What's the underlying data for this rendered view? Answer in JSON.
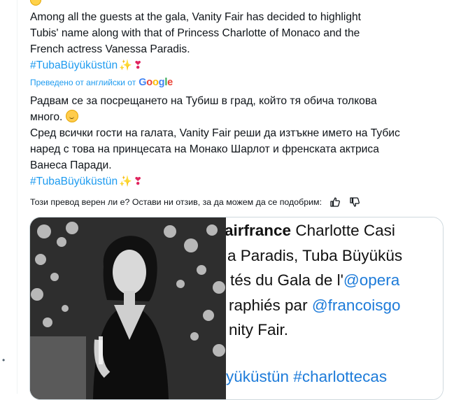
{
  "original": {
    "line1": "Among all the guests at the gala, Vanity Fair has decided to highlight",
    "line2": "Tubis' name along with that of Princess Charlotte of Monaco and the",
    "line3": "French actress Vanessa Paradis.",
    "hashtag": "#TubaBüyüküstün"
  },
  "translation": {
    "note": "Преведено от английски от",
    "provider": "Google",
    "line1": "Радвам се за посрещането на Тубиш в град, който тя обича толкова",
    "line2": "много.",
    "line3": "Сред всички гости на галата, Vanity Fair реши да изтъкне името на Тубис",
    "line4": "наред с това на принцесата на Монако Шарлот и френската актриса",
    "line5": "Ванеса Паради.",
    "hashtag": "#TubaBüyüküstün"
  },
  "feedback": {
    "question": "Този превод верен ли е? Остави ни отзив, за да можем да се подобрим:"
  },
  "icons": {
    "sparkles": "✨",
    "exclamation": "❣",
    "thumbs_up": "thumbs-up-icon",
    "thumbs_down": "thumbs-down-icon",
    "smiling_face": "smiling-face-with-tear-icon"
  },
  "media": {
    "screenshot_lines": [
      {
        "pre": "",
        "bold": "airfrance",
        "post": " Charlotte Casi"
      },
      {
        "pre": "a Paradis, Tuba Büyüküs",
        "bold": "",
        "post": ""
      },
      {
        "pre": "tés du Gala de l'",
        "link": "@opera",
        "post": ""
      },
      {
        "pre": "raphiés par ",
        "link": "@francoisgo",
        "post": ""
      },
      {
        "pre": "nity Fair.",
        "bold": "",
        "post": ""
      },
      {
        "pre": "",
        "link": "yüküstün #charlottecas",
        "post": ""
      }
    ]
  },
  "colors": {
    "link": "#1d9bf0",
    "text": "#0f1419",
    "border": "#cfd9de"
  }
}
